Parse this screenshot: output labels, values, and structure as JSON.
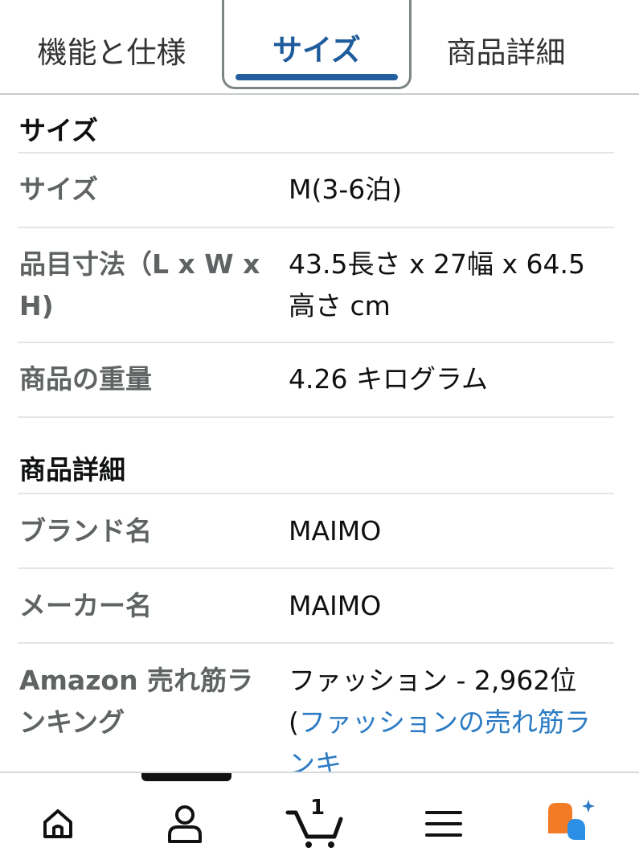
{
  "tabs": [
    {
      "label": "機能と仕様",
      "active": false
    },
    {
      "label": "サイズ",
      "active": true
    },
    {
      "label": "商品詳細",
      "active": false
    }
  ],
  "sections": {
    "size": {
      "title": "サイズ",
      "rows": [
        {
          "key": "サイズ",
          "value": "M(3-6泊)"
        },
        {
          "key": "品目寸法（L x W x H)",
          "value": "43.5長さ x 27幅 x 64.5高さ cm"
        },
        {
          "key": "商品の重量",
          "value": "4.26 キログラム"
        }
      ]
    },
    "details": {
      "title": "商品詳細",
      "rows": [
        {
          "key": "ブランド名",
          "value": "MAIMO"
        },
        {
          "key": "メーカー名",
          "value": "MAIMO"
        },
        {
          "key": "Amazon 売れ筋ランキング",
          "value": "ファッション - 2,962位 (",
          "link": "ファッションの売れ筋ランキ"
        }
      ]
    }
  },
  "nav": {
    "items": [
      {
        "name": "home-icon"
      },
      {
        "name": "account-icon"
      },
      {
        "name": "cart-icon"
      },
      {
        "name": "menu-icon"
      },
      {
        "name": "ai-assistant-icon"
      }
    ],
    "cart_count": "1"
  },
  "colors": {
    "active_tab_text": "#1f5c9b",
    "active_underline": "#235e9f",
    "link": "#2b7bc4",
    "label_gray": "#5f6363",
    "ai_orange": "#f47b26",
    "ai_blue": "#2b8fe6"
  }
}
